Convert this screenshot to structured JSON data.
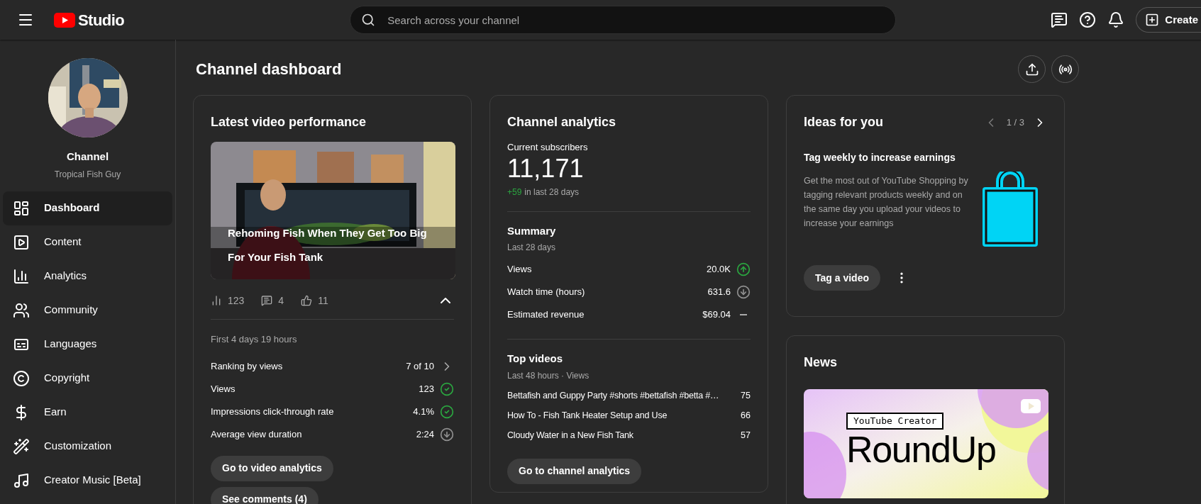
{
  "header": {
    "brand": "Studio",
    "search": {
      "placeholder": "Search across your channel"
    },
    "create_button": "Create"
  },
  "profile": {
    "name": "Channel",
    "subtitle": "Tropical Fish Guy"
  },
  "sidebar": {
    "items": [
      {
        "label": "Dashboard",
        "selected": true
      },
      {
        "label": "Content",
        "selected": false
      },
      {
        "label": "Analytics",
        "selected": false
      },
      {
        "label": "Community",
        "selected": false
      },
      {
        "label": "Languages",
        "selected": false
      },
      {
        "label": "Copyright",
        "selected": false
      },
      {
        "label": "Earn",
        "selected": false
      },
      {
        "label": "Customization",
        "selected": false
      },
      {
        "label": "Creator Music [Beta]",
        "selected": false
      }
    ]
  },
  "page_title": "Channel dashboard",
  "latest_video": {
    "title": "Latest video performance",
    "video_title": "Rehoming Fish When They Get Too Big For Your Fish Tank",
    "stats": [
      {
        "kind": "views",
        "value": "123"
      },
      {
        "kind": "comments",
        "value": "4"
      },
      {
        "kind": "likes",
        "value": "11"
      }
    ],
    "expanded": true,
    "period": "First 4 days 19 hours",
    "metrics": [
      {
        "label": "Ranking by views",
        "value": "7 of 10",
        "kind": "link"
      },
      {
        "label": "Views",
        "value": "123",
        "kind": "good"
      },
      {
        "label": "Impressions click-through rate",
        "value": "4.1%",
        "kind": "good"
      },
      {
        "label": "Average view duration",
        "value": "2:24",
        "kind": "down"
      }
    ],
    "buttons": [
      "Go to video analytics",
      "See comments (4)"
    ]
  },
  "channel_analytics": {
    "title": "Channel analytics",
    "subscribers_label": "Current subscribers",
    "subscribers": "11,171",
    "change": "+59",
    "change_suffix": "in last 28 days",
    "summary": {
      "title": "Summary",
      "subtitle": "Last 28 days",
      "rows": [
        {
          "label": "Views",
          "value": "20.0K",
          "kind": "up"
        },
        {
          "label": "Watch time (hours)",
          "value": "631.6",
          "kind": "down"
        },
        {
          "label": "Estimated revenue",
          "value": "$69.04",
          "kind": "flat"
        }
      ]
    },
    "top_videos": {
      "title": "Top videos",
      "subtitle": "Last 48 hours · Views",
      "rows": [
        {
          "title": "Bettafish and Guppy Party #shorts #bettafish #betta #…",
          "views": "75"
        },
        {
          "title": "How To - Fish Tank Heater Setup and Use",
          "views": "66"
        },
        {
          "title": "Cloudy Water in a New Fish Tank",
          "views": "57"
        }
      ]
    },
    "button": "Go to channel analytics"
  },
  "ideas": {
    "title": "Ideas for you",
    "pager": "1 / 3",
    "idea_title": "Tag weekly to increase earnings",
    "body": "Get the most out of YouTube Shopping by tagging relevant products weekly and on the same day you upload your videos to increase your earnings",
    "button": "Tag a video"
  },
  "news": {
    "title": "News",
    "banner": {
      "tag": "YouTube Creator",
      "headline": "RoundUp"
    }
  }
}
